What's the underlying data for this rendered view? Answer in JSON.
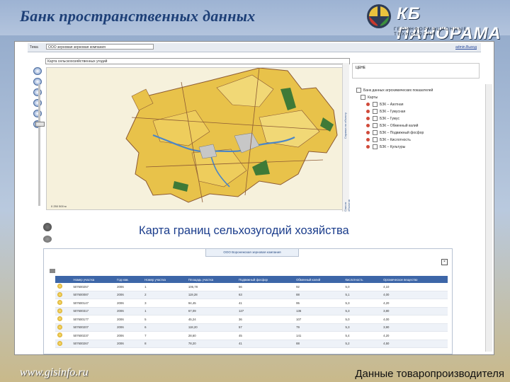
{
  "slide": {
    "title": "Банк пространственных данных",
    "site_url": "www.gisinfo.ru",
    "footer_caption": "Данные товаропроизводителя",
    "map_caption": "Карта границ сельхозугодий хозяйства"
  },
  "logo": {
    "name": "КБ ПАНОРАМА",
    "subtitle": "ГЕОИНФОРМАЦИОННЫЕ ТЕХНОЛОГИИ"
  },
  "app": {
    "header_label": "Тема",
    "header_select": "ООО зерновая зерновая компания",
    "header_link": "admin.Выход",
    "map_select": "Карта сельскохозяйственных угодий",
    "right_box_label": "ЦЕНЕ",
    "strip_label_1": "Справка по объекту",
    "strip_label_2": "Список объектов",
    "scale_text": "0   250   500 м",
    "layers": [
      {
        "label": "Банк данных агрохимических показателей",
        "kind": "root"
      },
      {
        "label": "Карты",
        "kind": "group"
      },
      {
        "label": "БЗК – Азотная",
        "kind": "layer"
      },
      {
        "label": "БЗК – Гумусная",
        "kind": "layer"
      },
      {
        "label": "БЗК – Гумус",
        "kind": "layer"
      },
      {
        "label": "БЗК – Обменный калий",
        "kind": "layer"
      },
      {
        "label": "БЗК – Подвижный фосфор",
        "kind": "layer"
      },
      {
        "label": "БЗК – Кислотность",
        "kind": "layer"
      },
      {
        "label": "БЗК – Культуры",
        "kind": "layer"
      }
    ]
  },
  "table": {
    "tab_label": "ООО Воронежская зерновая компания",
    "columns": [
      "Номер участка",
      "Год изм.",
      "Номер участка",
      "Площадь участка",
      "Подвижный фосфор",
      "Обменный калий",
      "Кислотность",
      "Органическое вещество"
    ],
    "rows": [
      [
        "507600257",
        "2006",
        "1",
        "106,78",
        "56",
        "92",
        "5,0",
        "4,10"
      ],
      [
        "507600087",
        "2006",
        "2",
        "119,28",
        "63",
        "88",
        "5,1",
        "4,00"
      ],
      [
        "507600147",
        "2006",
        "3",
        "94,45",
        "41",
        "95",
        "5,3",
        "4,20"
      ],
      [
        "507600317",
        "2006",
        "1",
        "67,09",
        "127",
        "136",
        "5,3",
        "3,80"
      ],
      [
        "507600177",
        "2006",
        "5",
        "45,24",
        "36",
        "107",
        "5,0",
        "4,00"
      ],
      [
        "507600207",
        "2006",
        "6",
        "118,20",
        "57",
        "79",
        "5,3",
        "3,90"
      ],
      [
        "507600237",
        "2006",
        "7",
        "28,60",
        "45",
        "141",
        "5,4",
        "4,20"
      ],
      [
        "507600267",
        "2006",
        "8",
        "78,20",
        "41",
        "88",
        "5,2",
        "4,50"
      ]
    ]
  },
  "colors": {
    "title": "#1d3f77",
    "caption": "#1b3d8c",
    "table_header": "#3d66a8",
    "field_yellow": "#e8c24a",
    "road_brown": "#8c5a34",
    "river_blue": "#4a86c8"
  }
}
